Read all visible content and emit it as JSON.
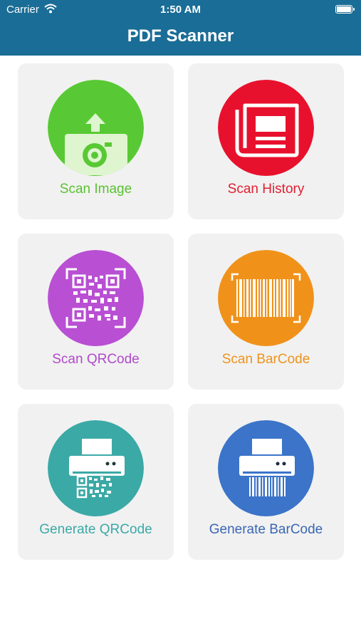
{
  "status_bar": {
    "carrier": "Carrier",
    "time": "1:50 AM"
  },
  "header": {
    "title": "PDF Scanner"
  },
  "tiles": [
    {
      "label": "Scan Image",
      "color": "#58c934",
      "text_color": "#59c231",
      "icon": "camera-upload-icon"
    },
    {
      "label": "Scan History",
      "color": "#e8112d",
      "text_color": "#e01f31",
      "icon": "newspaper-icon"
    },
    {
      "label": "Scan QRCode",
      "color": "#b94fd3",
      "text_color": "#b04acb",
      "icon": "qrcode-icon"
    },
    {
      "label": "Scan BarCode",
      "color": "#f0921a",
      "text_color": "#ef931c",
      "icon": "barcode-icon"
    },
    {
      "label": "Generate QRCode",
      "color": "#3ba9a6",
      "text_color": "#3ba9a6",
      "icon": "printer-qrcode-icon"
    },
    {
      "label": "Generate BarCode",
      "color": "#3b74c9",
      "text_color": "#3967b3",
      "icon": "printer-barcode-icon"
    }
  ]
}
